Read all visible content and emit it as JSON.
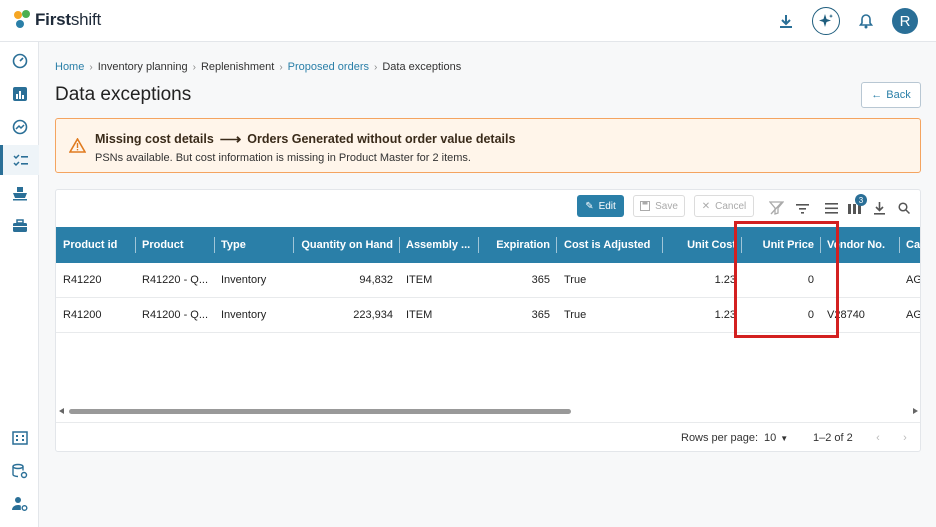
{
  "app": {
    "logo_bold": "First",
    "logo_light": "shift",
    "avatar_initial": "R"
  },
  "breadcrumb": {
    "home": "Home",
    "inventory_planning": "Inventory planning",
    "replenishment": "Replenishment",
    "proposed_orders": "Proposed orders",
    "current": "Data exceptions"
  },
  "page": {
    "title": "Data exceptions",
    "back_label": "Back"
  },
  "alert": {
    "title_left": "Missing cost details",
    "title_right": "Orders Generated without order value details",
    "body": "PSNs available. But cost information is missing in Product Master for 2 items."
  },
  "toolbar": {
    "edit_label": "Edit",
    "save_label": "Save",
    "cancel_label": "Cancel",
    "columns_badge": "3"
  },
  "table": {
    "headers": [
      "Product id",
      "Product",
      "Type",
      "Quantity on Hand",
      "Assembly ...",
      "Expiration",
      "Cost is Adjusted",
      "Unit Cost",
      "Unit Price",
      "Vendor No.",
      "Cat"
    ],
    "rows": [
      [
        "R41220",
        "R41220 - Q...",
        "Inventory",
        "94,832",
        "ITEM",
        "365",
        "True",
        "1.23",
        "0",
        "",
        "AG"
      ],
      [
        "R41200",
        "R41200 - Q...",
        "Inventory",
        "223,934",
        "ITEM",
        "365",
        "True",
        "1.23",
        "0",
        "V28740",
        "AG"
      ]
    ]
  },
  "footer": {
    "rows_per_page_label": "Rows per page:",
    "rows_per_page_value": "10",
    "range": "1–2 of 2"
  },
  "colors": {
    "accent": "#2a7fa8",
    "alert_border": "#f4a460",
    "highlight": "#d32020"
  }
}
